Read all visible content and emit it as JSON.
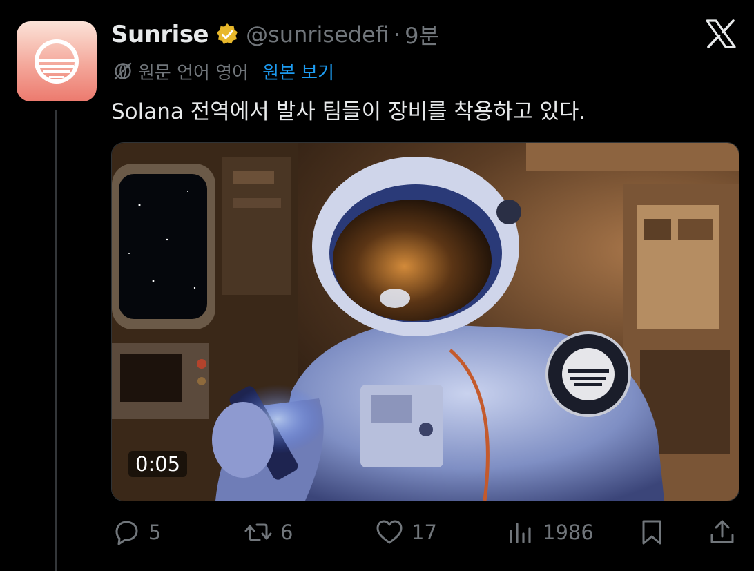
{
  "account": {
    "display_name": "Sunrise",
    "handle": "@sunrisedefi",
    "separator": "·",
    "time": "9분"
  },
  "translation": {
    "label": "원문 언어 영어",
    "show_original": "원본 보기"
  },
  "tweet_text": "Solana 전역에서 발사 팀들이 장비를 착용하고 있다.",
  "media": {
    "duration": "0:05"
  },
  "actions": {
    "replies": "5",
    "retweets": "6",
    "likes": "17",
    "views": "1986"
  },
  "icons": [
    "verified-badge-icon",
    "x-logo-icon",
    "globe-icon",
    "reply-icon",
    "retweet-icon",
    "like-icon",
    "views-icon",
    "bookmark-icon",
    "share-icon"
  ],
  "colors": {
    "background": "#000000",
    "text": "#e7e9ea",
    "secondary": "#71767b",
    "link": "#1d9bf0",
    "verified": "#e8b82b"
  }
}
